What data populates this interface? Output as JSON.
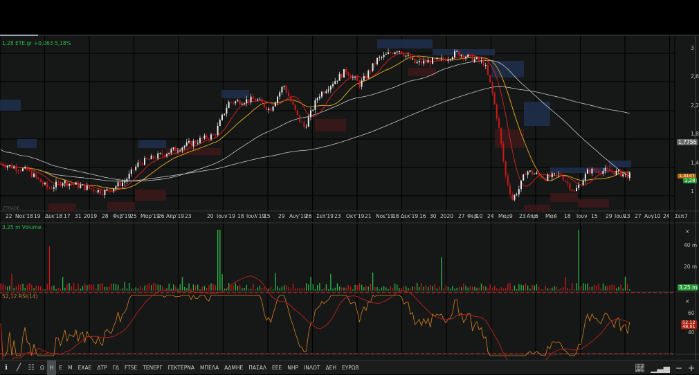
{
  "header": {
    "last": "1,28",
    "symbol": "ETE.gr",
    "change": "+0,063",
    "change_pct": "5,18%"
  },
  "watermark": "ZTRADE",
  "price_axis": {
    "ticks": [
      "3",
      "2,6",
      "2,2",
      "1,8",
      "1,4",
      "1"
    ],
    "sma_tag": "1,7756",
    "tag_a": "1,3147",
    "tag_b": "1,28"
  },
  "x_axis": [
    "22",
    "Νοε'18",
    "19",
    "Δεκ'18",
    "17",
    "31",
    "2019",
    "28",
    "Φεβ'19",
    "25",
    "Μαρ'19",
    "26",
    "Απρ'19",
    "23",
    "20",
    "Ιουν'19",
    "18",
    "Ιουλ'19",
    "15",
    "29",
    "Αυγ'19",
    "26",
    "Σεπ'19",
    "23",
    "Οκτ'19",
    "21",
    "Νοε'19",
    "18",
    "Δεκ'19",
    "16",
    "30",
    "2020",
    "27",
    "Φεβ",
    "10",
    "24",
    "Μαρ",
    "9",
    "23",
    "Απρ",
    "6",
    "Μαι",
    "4",
    "18",
    "Ιουν",
    "15",
    "29",
    "Ιουλ",
    "13",
    "27",
    "Αυγ",
    "10",
    "24",
    "Σεπ",
    "7"
  ],
  "volume": {
    "label": "3,25 m Volume",
    "ticks": [
      "40 m",
      "20 m"
    ],
    "tag": "3,25 m"
  },
  "rsi": {
    "label": "52,12 RSI(14)",
    "ticks": [
      "60",
      "40"
    ],
    "tag_a": "52,12",
    "tag_b": "48,91"
  },
  "toolbar": {
    "items": [
      "Ω",
      "Η",
      "Ε",
      "Μ",
      "ΕΧΑΕ",
      "ΔΤΡ",
      "ΓΔ",
      "FTSE",
      "ΤΕΝΕΡΓ",
      "ΓΕΚΤΕΡΝΑ",
      "ΜΠΕΛΑ",
      "ΑΔΜΗΕ",
      "ΠΑΣΑΛ",
      "ΕΕΕ",
      "ΝΗΡ",
      "ΙΝΛΟΤ",
      "ΔΕΗ",
      "ΕΥΡΩΒ"
    ],
    "active": "Η"
  },
  "close_x": "×",
  "colors": {
    "up": "#e8e8e8",
    "down": "#d01818",
    "ma1": "#d02020",
    "ma2": "#d8a020",
    "ma3": "#c8c8c8",
    "green": "#2db84a"
  },
  "chart_data": {
    "type": "candlestick",
    "anchors": [
      [
        0,
        1.45
      ],
      [
        40,
        1.35
      ],
      [
        70,
        1.1
      ],
      [
        90,
        1.2
      ],
      [
        130,
        1.1
      ],
      [
        150,
        1.05
      ],
      [
        180,
        1.2
      ],
      [
        200,
        1.45
      ],
      [
        240,
        1.6
      ],
      [
        280,
        1.75
      ],
      [
        310,
        1.85
      ],
      [
        330,
        2.3
      ],
      [
        370,
        2.35
      ],
      [
        390,
        2.2
      ],
      [
        410,
        2.55
      ],
      [
        430,
        2.1
      ],
      [
        440,
        1.95
      ],
      [
        460,
        2.4
      ],
      [
        500,
        2.75
      ],
      [
        520,
        2.55
      ],
      [
        545,
        2.9
      ],
      [
        575,
        3.05
      ],
      [
        600,
        2.85
      ],
      [
        640,
        2.9
      ],
      [
        660,
        3.0
      ],
      [
        700,
        2.85
      ],
      [
        710,
        2.5
      ],
      [
        720,
        2.0
      ],
      [
        730,
        1.3
      ],
      [
        740,
        0.95
      ],
      [
        750,
        1.1
      ],
      [
        760,
        1.35
      ],
      [
        790,
        1.25
      ],
      [
        810,
        1.3
      ],
      [
        830,
        1.05
      ],
      [
        850,
        1.35
      ],
      [
        880,
        1.35
      ],
      [
        910,
        1.28
      ]
    ]
  }
}
